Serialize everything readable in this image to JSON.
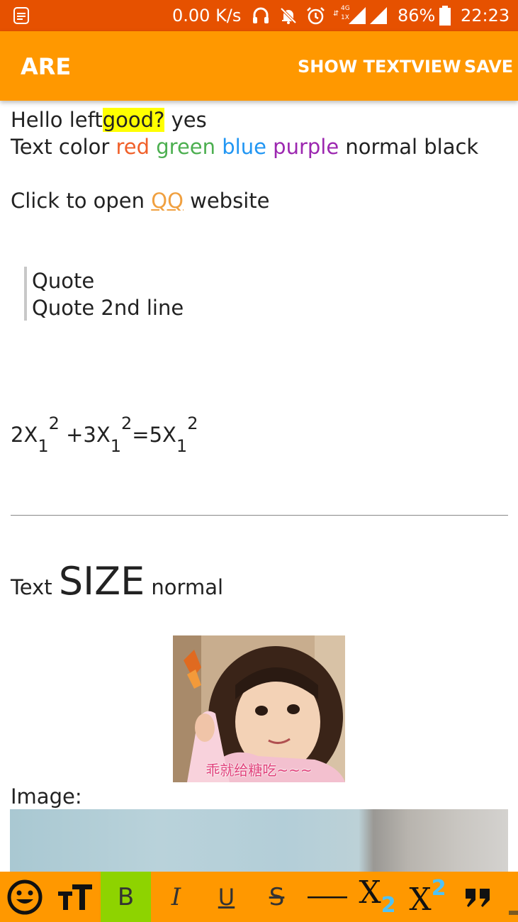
{
  "status_bar": {
    "network_speed": "0.00 K/s",
    "network_type_top": "4G",
    "network_type_bottom": "1X",
    "battery": "86%",
    "time": "22:23"
  },
  "app_bar": {
    "title": "ARE",
    "show_textview": "SHOW TEXTVIEW",
    "save": "SAVE"
  },
  "editor": {
    "line1": {
      "pre": "Hello left",
      "highlight": "good?",
      "post": " yes",
      "highlight_color": "#ffff00"
    },
    "line2": {
      "pre": "Text color ",
      "red": "red",
      "green": "green",
      "blue": "blue",
      "purple": "purple",
      "post": "normal black",
      "colors": {
        "red": "#f0602a",
        "green": "#4caf50",
        "blue": "#2196f3",
        "purple": "#9c27b0"
      }
    },
    "line3": {
      "pre": "Click to open ",
      "link": "QQ",
      "post": " website",
      "link_color": "#f0a040"
    },
    "quote": {
      "line1": "Quote",
      "line2": "Quote 2nd line"
    },
    "formula": {
      "t1": "2X",
      "sub1": "1",
      "sup1": "2",
      "t2": " +3X",
      "sub2": "1",
      "sup2": "2",
      "t3": "=5X",
      "sub3": "1",
      "sup3": "2"
    },
    "size_line": {
      "pre": "Text ",
      "big": "SIZE",
      "post": " normal"
    },
    "photo_caption": "乖就给糖吃~~~",
    "image_label": "Image:"
  },
  "toolbar": {
    "bold": "B",
    "italic": "I",
    "underline": "U",
    "strikethrough": "S",
    "subscript_base": "X",
    "subscript_num": "2",
    "superscript_base": "X",
    "superscript_num": "2",
    "icons": [
      "emoji-icon",
      "font-size-icon",
      "horizontal-rule-icon",
      "quote-icon"
    ],
    "accent": "#ff9800",
    "bold_active_bg": "#8ed300",
    "script_color": "#4fc3f7"
  }
}
